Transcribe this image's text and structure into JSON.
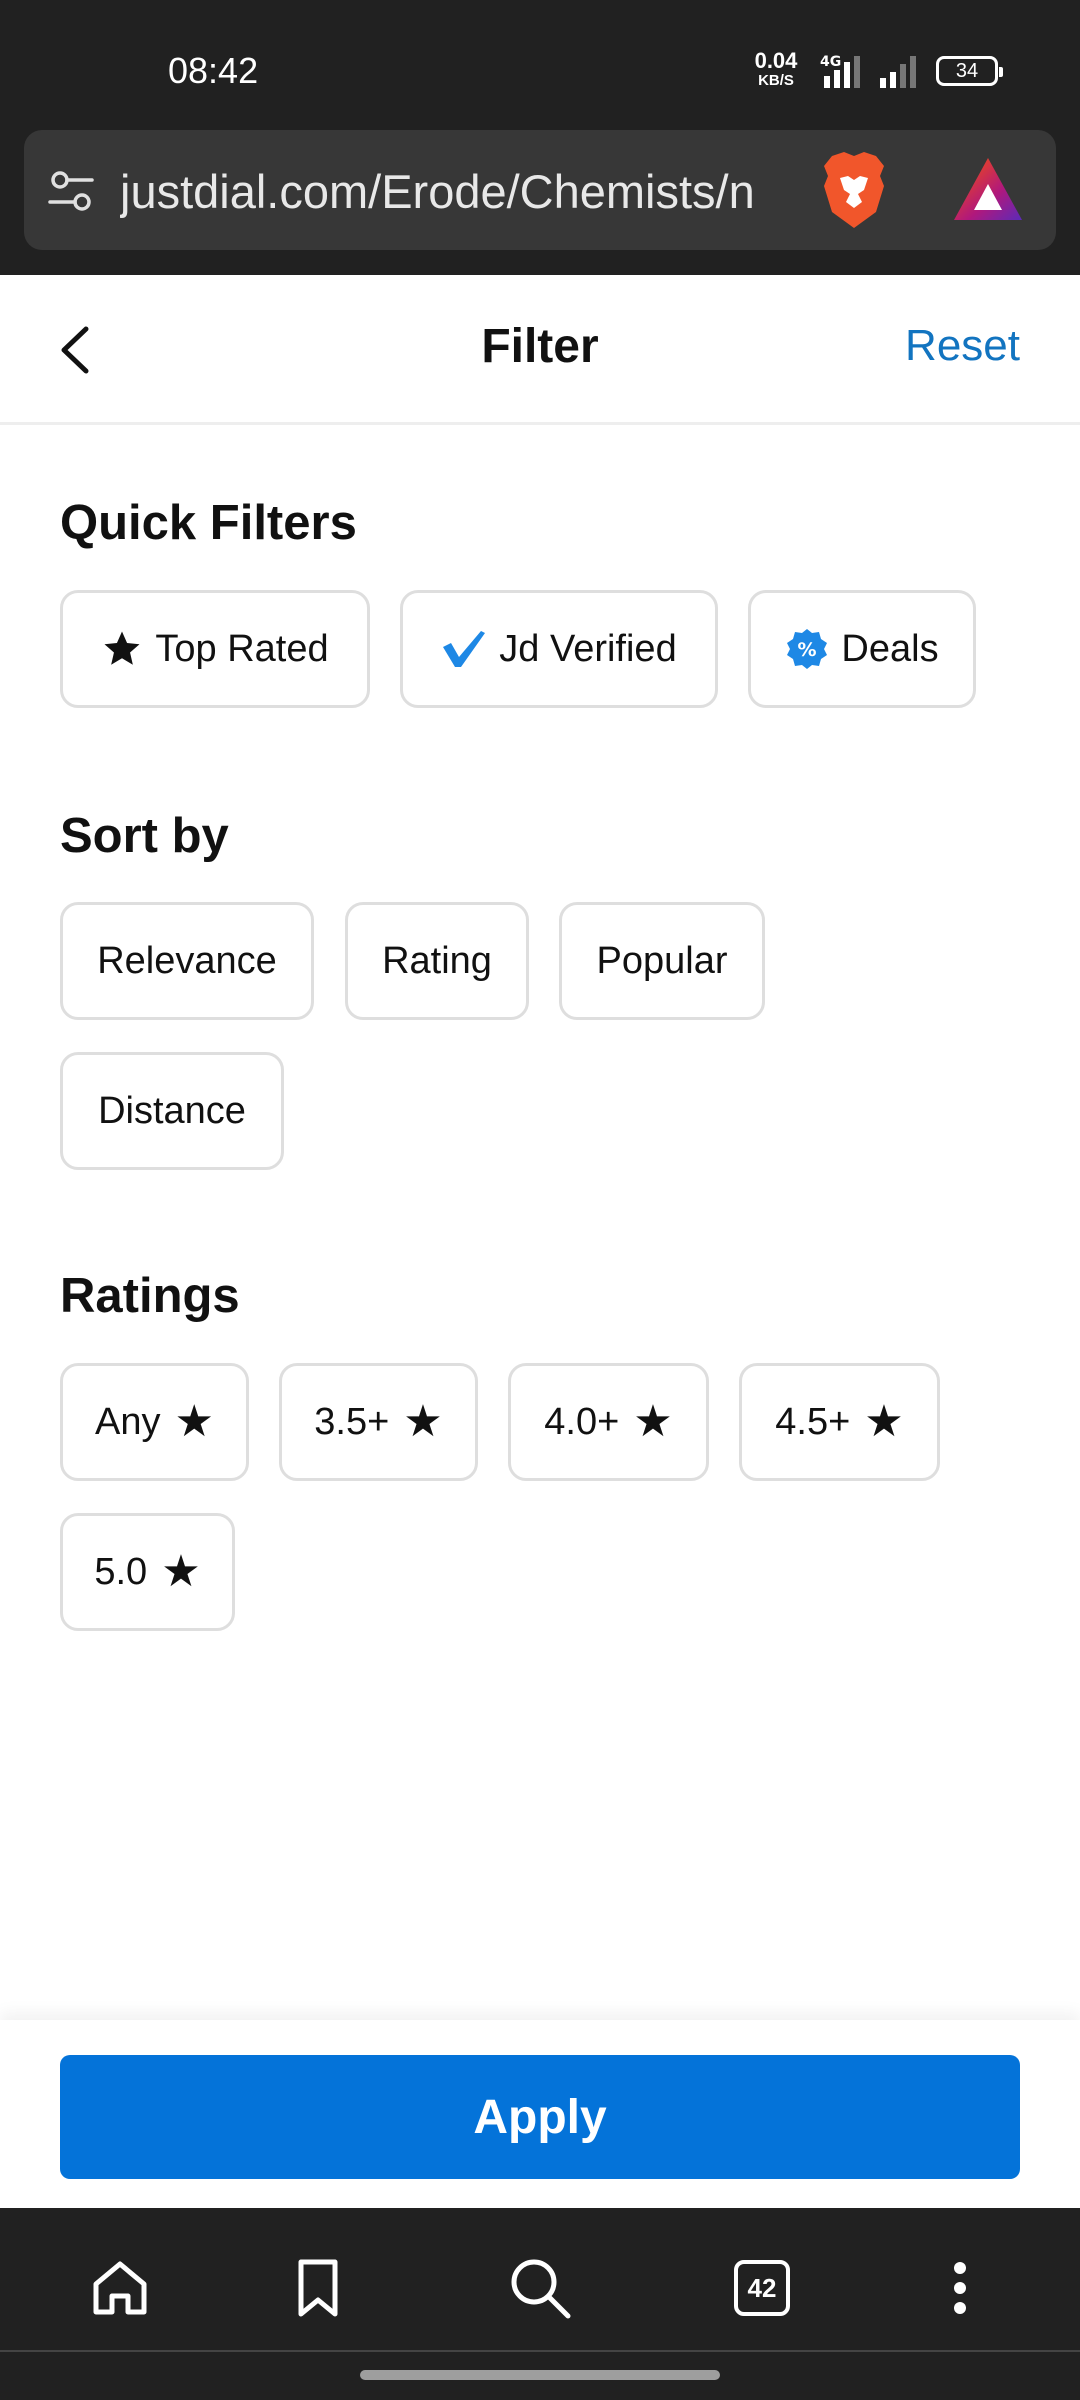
{
  "status_bar": {
    "time": "08:42",
    "speed_value": "0.04",
    "speed_unit": "KB/S",
    "network": "4G",
    "battery": "34"
  },
  "browser": {
    "url": "justdial.com/Erode/Chemists/n",
    "tab_count": "42"
  },
  "header": {
    "title": "Filter",
    "reset_label": "Reset"
  },
  "quick_filters": {
    "title": "Quick Filters",
    "items": [
      {
        "label": "Top Rated",
        "icon": "star-icon"
      },
      {
        "label": "Jd Verified",
        "icon": "verified-check-icon"
      },
      {
        "label": "Deals",
        "icon": "percent-badge-icon"
      }
    ]
  },
  "sort_by": {
    "title": "Sort by",
    "options": [
      "Relevance",
      "Rating",
      "Popular",
      "Distance"
    ]
  },
  "ratings": {
    "title": "Ratings",
    "options": [
      "Any",
      "3.5+",
      "4.0+",
      "4.5+",
      "5.0"
    ],
    "star": "★"
  },
  "apply_label": "Apply",
  "colors": {
    "accent": "#0473d9",
    "reset": "#1274c0",
    "chrome_bg": "#212121"
  }
}
